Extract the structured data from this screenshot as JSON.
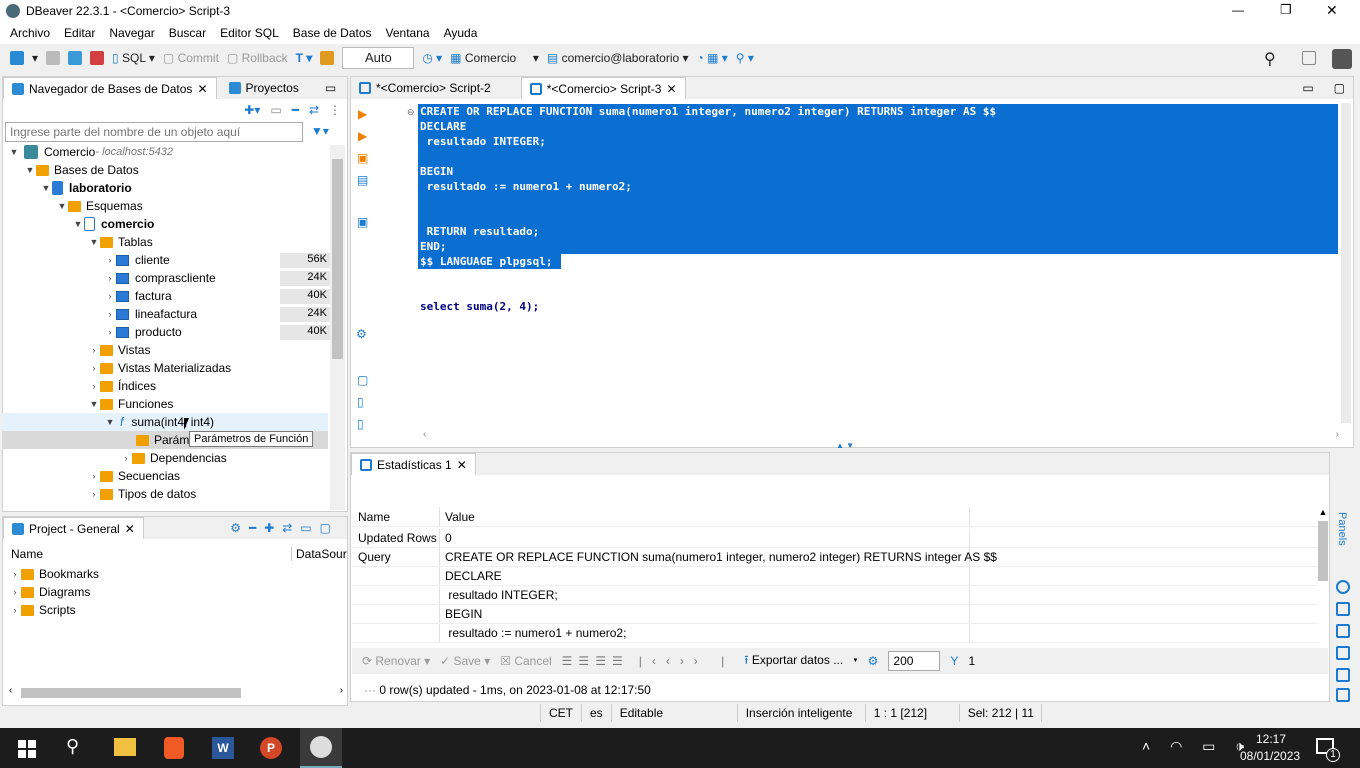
{
  "window": {
    "title": "DBeaver 22.3.1 - <Comercio> Script-3",
    "minimize": "—",
    "restore": "❐",
    "close": "✕"
  },
  "menu": [
    "Archivo",
    "Editar",
    "Navegar",
    "Buscar",
    "Editor SQL",
    "Base de Datos",
    "Ventana",
    "Ayuda"
  ],
  "toolbar": {
    "sql": "SQL",
    "commit": "Commit",
    "rollback": "Rollback",
    "mode": "Auto",
    "datasource": "Comercio",
    "schema": "comercio@laboratorio"
  },
  "navigator": {
    "tab1": "Navegador de Bases de Datos",
    "tab2": "Proyectos",
    "filter_placeholder": "Ingrese parte del nombre de un objeto aquí",
    "tree": [
      {
        "label": "Comercio",
        "hint": " - localhost:5432"
      },
      {
        "label": "Bases de Datos"
      },
      {
        "label": "laboratorio"
      },
      {
        "label": "Esquemas"
      },
      {
        "label": "comercio"
      },
      {
        "label": "Tablas"
      },
      {
        "label": "cliente",
        "size": "56K"
      },
      {
        "label": "comprascliente",
        "size": "24K"
      },
      {
        "label": "factura",
        "size": "40K"
      },
      {
        "label": "lineafactura",
        "size": "24K"
      },
      {
        "label": "producto",
        "size": "40K"
      },
      {
        "label": "Vistas"
      },
      {
        "label": "Vistas Materializadas"
      },
      {
        "label": "Índices"
      },
      {
        "label": "Funciones"
      },
      {
        "label": "suma(int4, int4)"
      },
      {
        "label": "Parám"
      },
      {
        "label": "Dependencias"
      },
      {
        "label": "Secuencias"
      },
      {
        "label": "Tipos de datos"
      }
    ],
    "tooltip": "Parámetros de Función"
  },
  "project": {
    "tab": "Project - General",
    "col_name": "Name",
    "col_ds": "DataSource",
    "items": [
      "Bookmarks",
      "Diagrams",
      "Scripts"
    ]
  },
  "editor": {
    "tabs": [
      "*<Comercio> Script-2",
      "*<Comercio> Script-3"
    ],
    "lines": [
      "CREATE OR REPLACE FUNCTION suma(numero1 integer, numero2 integer) RETURNS integer AS $$",
      "DECLARE",
      " resultado INTEGER;",
      "",
      "BEGIN",
      " resultado := numero1 + numero2;",
      "",
      "",
      " RETURN resultado;",
      "END;",
      "$$ LANGUAGE plpgsql;"
    ],
    "query": "select suma(2, 4);"
  },
  "results": {
    "tab": "Estadísticas 1",
    "col_name": "Name",
    "col_value": "Value",
    "rows": [
      [
        "Updated Rows",
        "0"
      ],
      [
        "Query",
        "CREATE OR REPLACE FUNCTION suma(numero1 integer, numero2 integer) RETURNS integer AS $$"
      ],
      [
        "",
        "DECLARE"
      ],
      [
        "",
        " resultado INTEGER;"
      ],
      [
        "",
        "BEGIN"
      ],
      [
        "",
        " resultado := numero1 + numero2;"
      ]
    ],
    "renovar": "Renovar",
    "save": "Save",
    "cancel": "Cancel",
    "export": "Exportar datos ...",
    "limit": "200",
    "count": "1",
    "status": "0 row(s) updated - 1ms, on 2023-01-08 at 12:17:50",
    "panels": "Panels"
  },
  "statusbar": [
    "CET",
    "es",
    "Editable",
    "Inserción inteligente",
    "1 : 1 [212]",
    "Sel: 212 | 11"
  ],
  "taskbar": {
    "time": "12:17",
    "date": "08/01/2023",
    "notif": "1"
  }
}
